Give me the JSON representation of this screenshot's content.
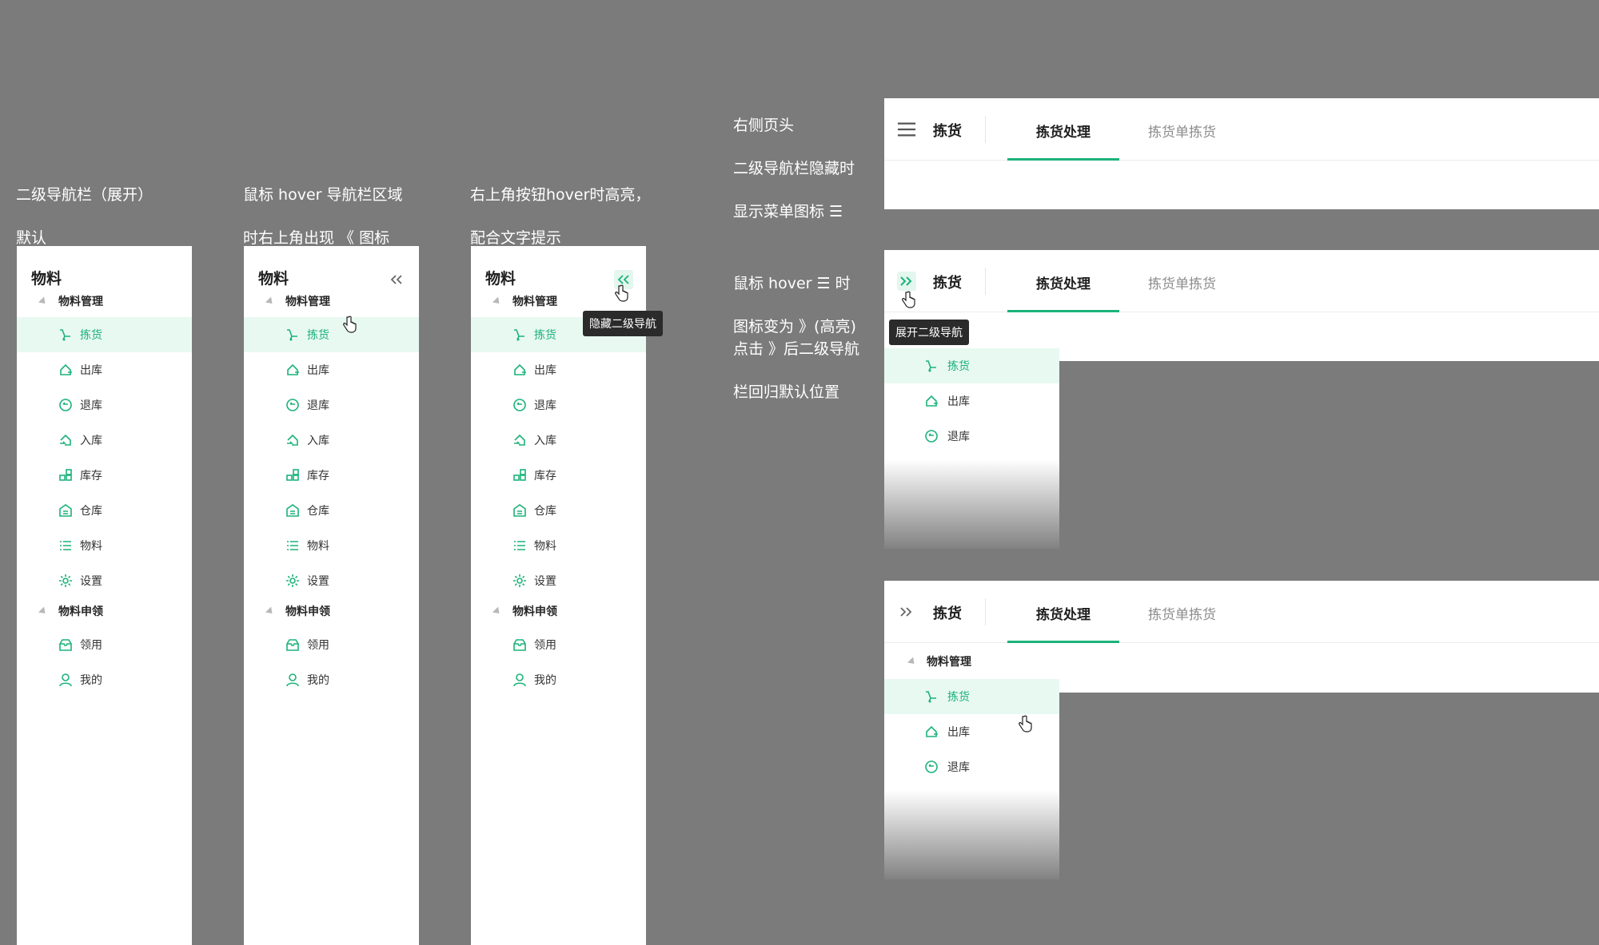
{
  "captions": {
    "c1": [
      "二级导航栏（展开）",
      "默认"
    ],
    "c2": [
      "鼠标 hover 导航栏区域",
      "时右上角出现 《 图标"
    ],
    "c3": [
      "右上角按钮hover时高亮，",
      "配合文字提示"
    ],
    "c4": [
      "右侧页头",
      "二级导航栏隐藏时",
      "显示菜单图标 ☰"
    ],
    "c5": [
      "鼠标 hover ☰ 时",
      "图标变为 》(高亮)"
    ],
    "c6": [
      "点击 》后二级导航",
      "栏回归默认位置"
    ]
  },
  "sidebar": {
    "title": "物料",
    "groups": [
      {
        "label": "物料管理",
        "items": [
          {
            "label": "拣货",
            "icon": "pick-icon",
            "active": true
          },
          {
            "label": "出库",
            "icon": "outbound-icon"
          },
          {
            "label": "退库",
            "icon": "return-icon"
          },
          {
            "label": "入库",
            "icon": "inbound-icon"
          },
          {
            "label": "库存",
            "icon": "inventory-icon"
          },
          {
            "label": "仓库",
            "icon": "warehouse-icon"
          },
          {
            "label": "物料",
            "icon": "list-icon"
          },
          {
            "label": "设置",
            "icon": "gear-icon"
          }
        ]
      },
      {
        "label": "物料申领",
        "items": [
          {
            "label": "领用",
            "icon": "receive-icon"
          },
          {
            "label": "我的",
            "icon": "user-icon"
          }
        ]
      }
    ]
  },
  "tooltips": {
    "hide_nav": "隐藏二级导航",
    "expand_nav": "展开二级导航"
  },
  "header": {
    "title": "拣货",
    "tabs": [
      {
        "label": "拣货处理",
        "active": true
      },
      {
        "label": "拣货单拣货",
        "active": false
      }
    ]
  },
  "colors": {
    "accent": "#1cb27a",
    "active_bg": "#e8f9f1",
    "background": "#7b7b7b"
  }
}
